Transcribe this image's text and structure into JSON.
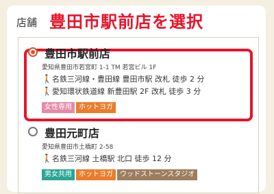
{
  "section": {
    "label": "店舗",
    "callout": "豊田市駅前店を選択"
  },
  "stores": [
    {
      "name": "豊田市駅前店",
      "selected": true,
      "address": "愛知県豊田市若宮町 1-1 TM 若宮ビル 1F",
      "access": [
        "名鉄三河線・豊田線 豊田市駅 改札 徒歩 2 分",
        "愛知環状鉄道線 新豊田駅 2F 改札 徒歩 3 分"
      ],
      "tags": [
        "女性専用",
        "ホットヨガ"
      ]
    },
    {
      "name": "豊田元町店",
      "selected": false,
      "address": "愛知県豊田市土橋町 2-58",
      "access": [
        "名鉄三河線 土橋駅 北口 徒歩 12 分"
      ],
      "tags": [
        "男女共用",
        "ホットヨガ",
        "ウッドストーンスタジオ"
      ]
    }
  ],
  "colors": {
    "accent_red": "#e8132a",
    "radio_selected": "#d9542b",
    "tag_women": "#e58aa8",
    "tag_hot": "#ea7d2c",
    "tag_mixed": "#2aa595",
    "tag_wood": "#9c7d5d"
  },
  "icons": {
    "access": "walking-person-icon",
    "radio": "radio-button-icon"
  }
}
